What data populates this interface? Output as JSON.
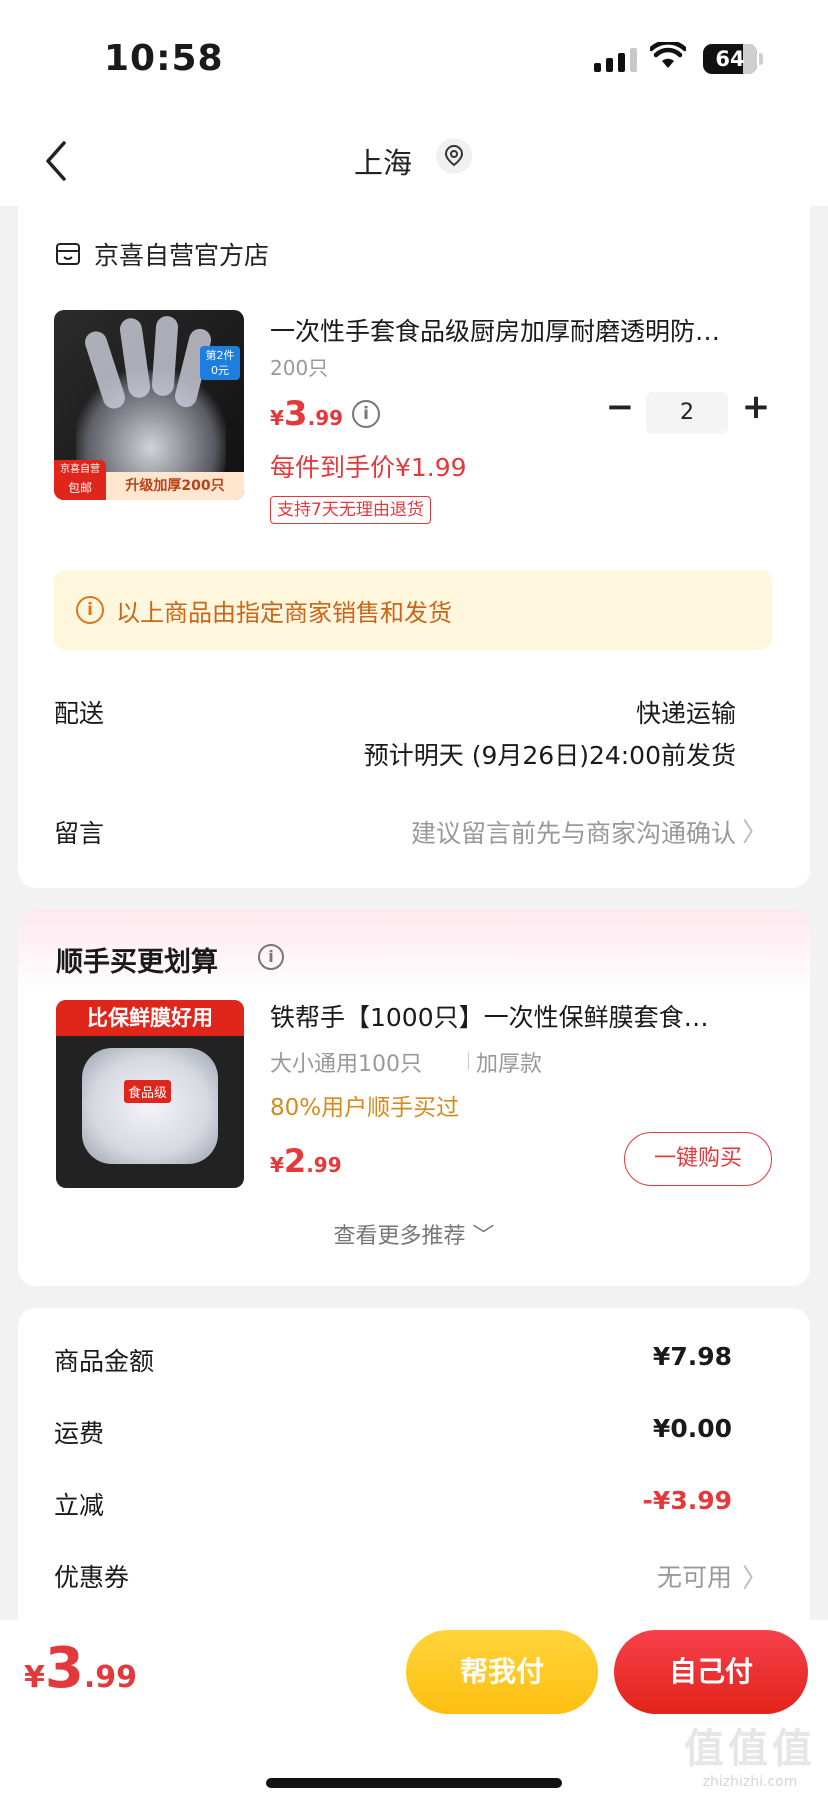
{
  "status_bar": {
    "time": "10:58",
    "battery": "64"
  },
  "nav": {
    "title": "上海"
  },
  "store": {
    "name": "京喜自营官方店"
  },
  "product": {
    "title": "一次性手套食品级厨房加厚耐磨透明防…",
    "spec": "200只",
    "price_currency": "¥",
    "price_int": "3",
    "price_dec": ".99",
    "quantity": "2",
    "unit_price": "每件到手价¥1.99",
    "return_policy": "支持7天无理由退货",
    "badge_top": "第2件",
    "badge_bottom": "0元",
    "tag_store_top": "京喜自营",
    "tag_store_bottom": "包邮",
    "tag_upgrade": "升级加厚200只"
  },
  "notice": {
    "text": "以上商品由指定商家销售和发货"
  },
  "delivery": {
    "label": "配送",
    "method": "快递运输",
    "eta": "预计明天 (9月26日)24:00前发货"
  },
  "message": {
    "label": "留言",
    "placeholder": "建议留言前先与商家沟通确认"
  },
  "recommend": {
    "title": "顺手买更划算",
    "banner": "比保鲜膜好用",
    "food_tag": "食品级",
    "name": "铁帮手【1000只】一次性保鲜膜套食…",
    "spec1": "大小通用100只",
    "spec2": "加厚款",
    "stat": "80%用户顺手买过",
    "price_currency": "¥",
    "price_int": "2",
    "price_dec": ".99",
    "buy_label": "一键购买",
    "more_label": "查看更多推荐"
  },
  "summary": {
    "rows": [
      {
        "label": "商品金额",
        "value": "¥7.98"
      },
      {
        "label": "运费",
        "value": "¥0.00"
      },
      {
        "label": "立减",
        "value": "-¥3.99"
      },
      {
        "label": "优惠券",
        "value": "无可用"
      }
    ]
  },
  "footer": {
    "total_currency": "¥",
    "total_int": "3",
    "total_dec": ".99",
    "help_pay_label": "帮我付",
    "self_pay_label": "自己付",
    "watermark": "值值值",
    "watermark_url": "zhizhizhi.com"
  },
  "colors": {
    "accent": "#e4393c",
    "notice_bg": "#fff7dd",
    "notice_text": "#c9661a",
    "help_pay": "#ffc81f"
  }
}
